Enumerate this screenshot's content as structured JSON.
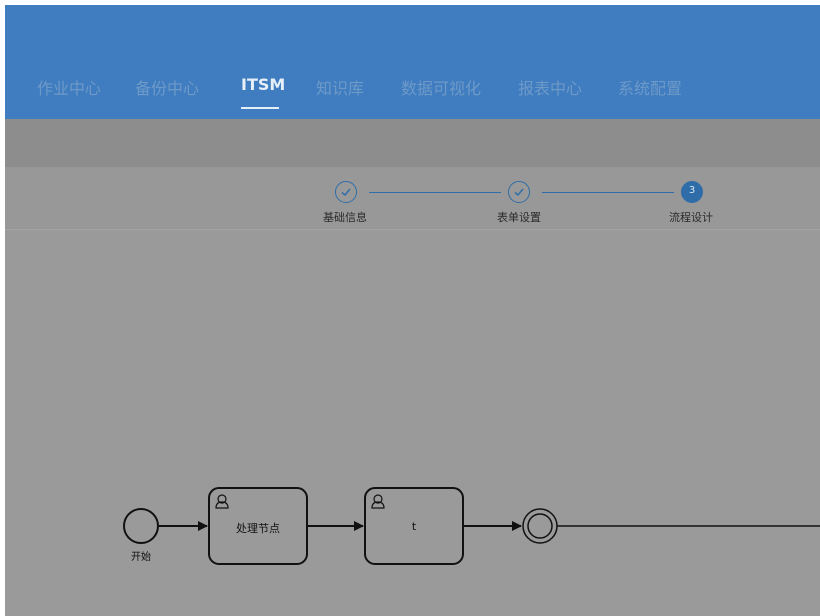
{
  "nav": {
    "items": [
      {
        "label": "作业中心"
      },
      {
        "label": "备份中心"
      },
      {
        "label": "ITSM"
      },
      {
        "label": "知识库"
      },
      {
        "label": "数据可视化"
      },
      {
        "label": "报表中心"
      },
      {
        "label": "系统配置"
      }
    ],
    "active_index": 2
  },
  "steps": [
    {
      "label": "基础信息",
      "status": "completed"
    },
    {
      "label": "表单设置",
      "status": "completed"
    },
    {
      "label": "流程设计",
      "status": "active",
      "number": "3"
    }
  ],
  "diagram": {
    "start_event": {
      "label": "开始"
    },
    "tasks": [
      {
        "label": "处理节点",
        "icon": "user-icon"
      },
      {
        "label": "t",
        "icon": "user-icon"
      }
    ],
    "end_event": {
      "label": ""
    }
  },
  "colors": {
    "header": "#3f7cc0",
    "accent": "#2f6da8",
    "overlay_background": "#9a9a9a"
  }
}
